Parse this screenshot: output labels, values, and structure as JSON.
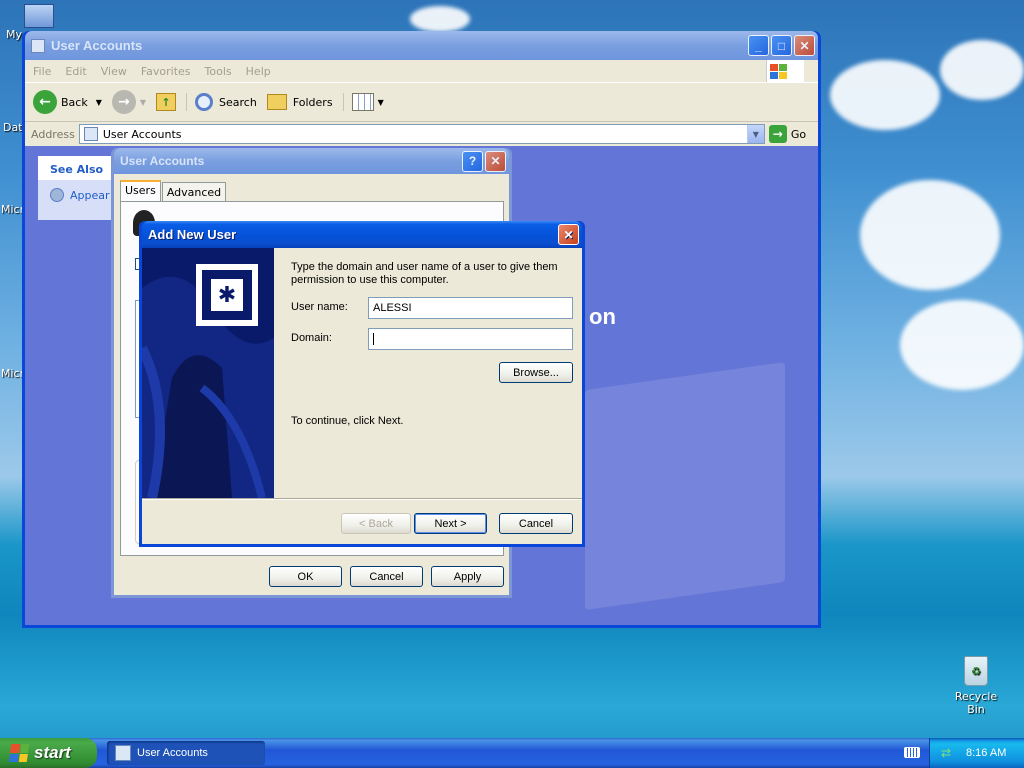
{
  "desktop": {
    "icons": [
      {
        "label": "My"
      },
      {
        "label": "Dat"
      },
      {
        "label": "Micro"
      },
      {
        "label": "Micro"
      },
      {
        "label": "Recycle Bin"
      }
    ]
  },
  "explorer": {
    "title": "User Accounts",
    "menu": [
      "File",
      "Edit",
      "View",
      "Favorites",
      "Tools",
      "Help"
    ],
    "toolbar": {
      "back": "Back",
      "search": "Search",
      "folders": "Folders"
    },
    "address_label": "Address",
    "address_value": "User Accounts",
    "go_label": "Go",
    "see_also_title": "See Also",
    "see_also_item": "Appear",
    "bg_text": "on"
  },
  "user_accounts_dialog": {
    "title": "User Accounts",
    "help_glyph": "?",
    "close_glyph": "✕",
    "tabs": [
      "Users",
      "Advanced"
    ],
    "ok": "OK",
    "cancel": "Cancel",
    "apply": "Apply"
  },
  "add_user_dialog": {
    "title": "Add New User",
    "close_glyph": "✕",
    "instruction": "Type the domain and user name of a user to give them permission to use this computer.",
    "username_label": "User name:",
    "username_value": "ALESSI",
    "domain_label": "Domain:",
    "domain_value": "",
    "browse": "Browse...",
    "continue_text": "To continue, click Next.",
    "back": "< Back",
    "next": "Next >",
    "cancel": "Cancel"
  },
  "taskbar": {
    "start": "start",
    "task": "User Accounts",
    "clock": "8:16 AM"
  }
}
